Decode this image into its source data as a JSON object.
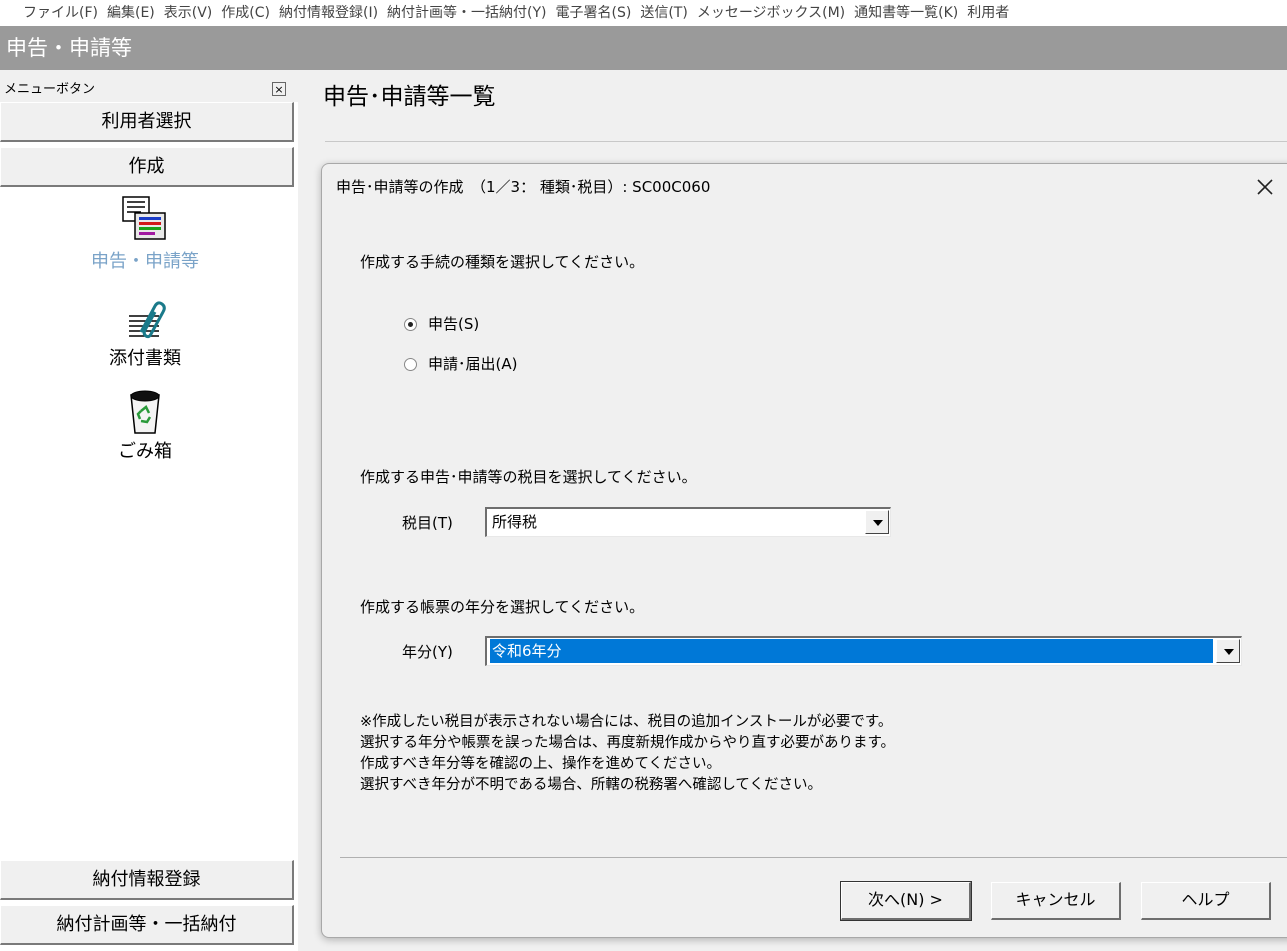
{
  "menu": [
    "ファイル(F)",
    "編集(E)",
    "表示(V)",
    "作成(C)",
    "納付情報登録(I)",
    "納付計画等・一括納付(Y)",
    "電子署名(S)",
    "送信(T)",
    "メッセージボックス(M)",
    "通知書等一覧(K)",
    "利用者"
  ],
  "window": {
    "title": "申告・申請等"
  },
  "sidebar": {
    "header": "メニューボタン",
    "close_glyph": "×",
    "top_buttons": [
      "利用者選択",
      "作成"
    ],
    "items": [
      {
        "label": "申告・申請等",
        "icon": "form-document-icon",
        "color": "#7aa3c8"
      },
      {
        "label": "添付書類",
        "icon": "attachment-paperclip-icon"
      },
      {
        "label": "ごみ箱",
        "icon": "recycle-bin-icon"
      }
    ],
    "bottom_buttons": [
      "納付情報登録",
      "納付計画等・一括納付"
    ]
  },
  "main": {
    "title": "申告･申請等一覧"
  },
  "dialog": {
    "title": "申告･申請等の作成　（1／3： 種類･税目）: SC00C060",
    "q1": "作成する手続の種類を選択してください。",
    "radios": [
      {
        "label": "申告(S)",
        "checked": true
      },
      {
        "label": "申請･届出(A)",
        "checked": false
      }
    ],
    "q2": "作成する申告･申請等の税目を選択してください。",
    "tax_label": "税目(T)",
    "tax_value": "所得税",
    "q3": "作成する帳票の年分を選択してください。",
    "year_label": "年分(Y)",
    "year_value": "令和6年分",
    "notes": [
      "※作成したい税目が表示されない場合には、税目の追加インストールが必要です。",
      "選択する年分や帳票を誤った場合は、再度新規作成からやり直す必要があります。",
      "作成すべき年分等を確認の上、操作を進めてください。",
      "選択すべき年分が不明である場合、所轄の税務署へ確認してください。"
    ],
    "buttons": {
      "next": "次へ(N) >",
      "cancel": "キャンセル",
      "help": "ヘルプ"
    },
    "selection_color": "#0078d7"
  }
}
